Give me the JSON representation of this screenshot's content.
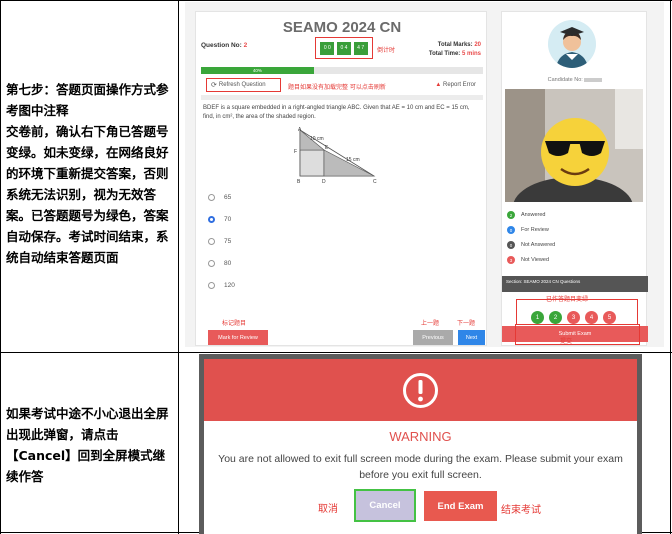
{
  "rows": [
    {
      "text": "第七步：答题页面操作方式参考图中注释\n交卷前，确认右下角已答题号变绿。如未变绿，在网络良好的环境下重新提交答案，否则系统无法识别，视为无效答案。已答题题号为绿色，答案自动保存。考试时间结束，系统自动结束答题页面"
    },
    {
      "text": "如果考试中途不小心退出全屏出现此弹窗，请点击【Cancel】回到全屏模式继续作答"
    }
  ],
  "exam": {
    "title": "SEAMO 2024 CN",
    "question_no_label": "Question No:",
    "question_no": "2",
    "timer": [
      "0 0",
      "0 4",
      "4 7"
    ],
    "timer_note": "倒计时",
    "total_marks_label": "Total Marks:",
    "total_marks": "20",
    "total_time_label": "Total Time:",
    "total_time": "5 mins",
    "progress_label": "40%",
    "progress": 0.4,
    "refresh_label": "Refresh Question",
    "refresh_note": "题目如果没有加载完整 可以点击刷新",
    "report_label": "Report Error",
    "question_text": "BDEF is a square embedded in a right-angled triangle ABC. Given that AE = 10 cm and EC = 15 cm, find, in cm², the area of the shaded region.",
    "figure": {
      "labels": [
        "A",
        "E",
        "F",
        "B",
        "D",
        "C"
      ],
      "ae": "10 cm",
      "ec": "15 cm"
    },
    "options": [
      "65",
      "70",
      "75",
      "80",
      "120"
    ],
    "selected_index": 1,
    "mark_note": "标记题目",
    "prev_note": "上一题",
    "next_note": "下一题",
    "mark_label": "Mark for Review",
    "prev_label": "Previous",
    "next_label": "Next"
  },
  "side": {
    "candidate_label": "Candidate No:",
    "legend": [
      {
        "num": "2",
        "label": "Answered",
        "color": "#3aa63a"
      },
      {
        "num": "0",
        "label": "For Review",
        "color": "#2f86e8"
      },
      {
        "num": "0",
        "label": "Not Answered",
        "color": "#555555"
      },
      {
        "num": "3",
        "label": "Not Viewed",
        "color": "#e85a5a"
      }
    ],
    "section_label": "Section: SEAMO 2024 CN Questions",
    "answered_note": "已作答题目变绿",
    "questions": [
      {
        "num": "1",
        "color": "#3aa63a"
      },
      {
        "num": "2",
        "color": "#3aa63a"
      },
      {
        "num": "3",
        "color": "#e85a5a"
      },
      {
        "num": "4",
        "color": "#e85a5a"
      },
      {
        "num": "5",
        "color": "#e85a5a"
      }
    ],
    "submit_label": "Submit Exam",
    "submit_note": "提交"
  },
  "modal": {
    "title": "WARNING",
    "message": "You are not allowed to exit full screen mode during the exam. Please submit your exam before you exit full screen.",
    "cancel_label": "Cancel",
    "end_label": "End Exam",
    "cancel_note": "取消",
    "end_note": "结束考试"
  },
  "colors": {
    "accent_red": "#e53935",
    "modal_red": "#e0514e",
    "green": "#3aa63a",
    "blue": "#2f86e8"
  }
}
